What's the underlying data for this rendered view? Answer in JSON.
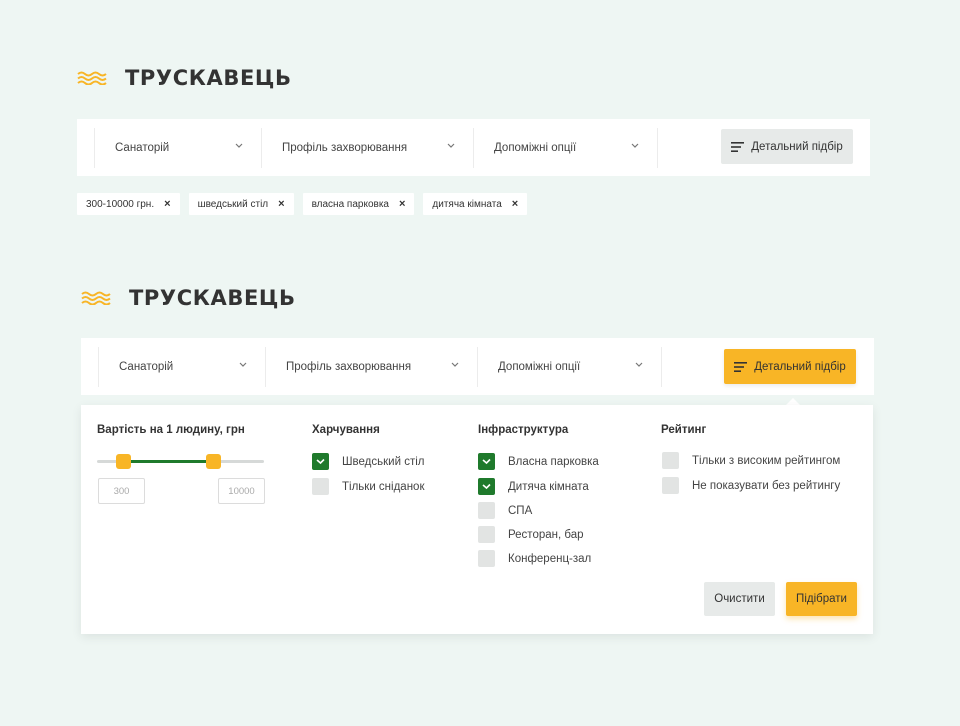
{
  "city_title": "ТРУСКАВЕЦЬ",
  "filters": {
    "type": "Санаторій",
    "profile": "Профіль захворювання",
    "options": "Допоміжні опції",
    "detail_button": "Детальний підбір"
  },
  "tags": [
    {
      "label": "300-10000 грн."
    },
    {
      "label": "шведський стіл"
    },
    {
      "label": "власна парковка"
    },
    {
      "label": "дитяча кімната"
    }
  ],
  "panel": {
    "price": {
      "title": "Вартість на 1 людину, грн",
      "min_placeholder": "300",
      "max_placeholder": "10000",
      "range_fraction": [
        0.16,
        0.7
      ]
    },
    "food": {
      "title": "Харчування",
      "items": [
        {
          "label": "Шведський стіл",
          "checked": true
        },
        {
          "label": "Тільки сніданок",
          "checked": false
        }
      ]
    },
    "infra": {
      "title": "Інфраструктура",
      "items": [
        {
          "label": "Власна парковка",
          "checked": true
        },
        {
          "label": "Дитяча кімната",
          "checked": true
        },
        {
          "label": "СПА",
          "checked": false
        },
        {
          "label": "Ресторан, бар",
          "checked": false
        },
        {
          "label": "Конференц-зал",
          "checked": false
        }
      ]
    },
    "rating": {
      "title": "Рейтинг",
      "items": [
        {
          "label": "Тільки з високим рейтингом",
          "checked": false
        },
        {
          "label": "Не показувати без рейтингу",
          "checked": false
        }
      ]
    },
    "clear_button": "Очистити",
    "apply_button": "Підібрати"
  },
  "colors": {
    "background": "#eef6f3",
    "accent_yellow": "#f8b526",
    "accent_green": "#1f7a2c",
    "neutral_button": "#e7eae9"
  },
  "icons": [
    "waves-logo-icon",
    "chevron-down-icon",
    "filter-lines-icon",
    "close-icon",
    "checkmark-icon"
  ]
}
